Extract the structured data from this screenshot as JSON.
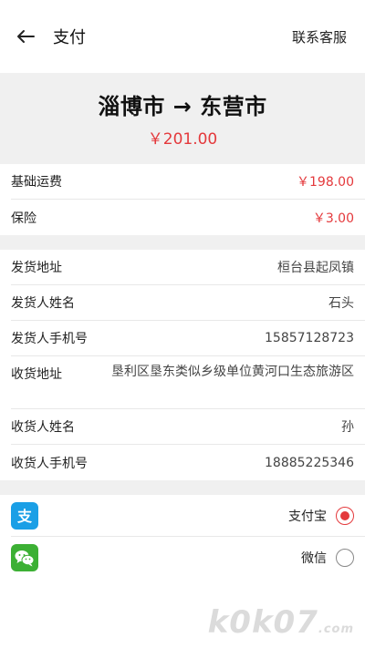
{
  "header": {
    "title": "支付",
    "service_label": "联系客服"
  },
  "route": {
    "text": "淄博市 → 东营市",
    "total": "￥201.00"
  },
  "fees": [
    {
      "label": "基础运费",
      "value": "￥198.00"
    },
    {
      "label": "保险",
      "value": "￥3.00"
    }
  ],
  "shipping": [
    {
      "label": "发货地址",
      "value": "桓台县起凤镇"
    },
    {
      "label": "发货人姓名",
      "value": "石头"
    },
    {
      "label": "发货人手机号",
      "value": "15857128723"
    },
    {
      "label": "收货地址",
      "value": "垦利区垦东类似乡级单位黄河口生态旅游区"
    },
    {
      "label": "收货人姓名",
      "value": "孙"
    },
    {
      "label": "收货人手机号",
      "value": "18885225346"
    }
  ],
  "payment": {
    "alipay_label": "支付宝",
    "wechat_label": "微信",
    "selected": "alipay"
  },
  "colors": {
    "accent": "#e4393c",
    "alipay": "#1a9fe6",
    "wechat": "#3cb034"
  },
  "icons": [
    "back-arrow-icon",
    "alipay-icon",
    "wechat-icon"
  ],
  "watermark": {
    "main": "k0k07",
    "suffix": ".com"
  }
}
